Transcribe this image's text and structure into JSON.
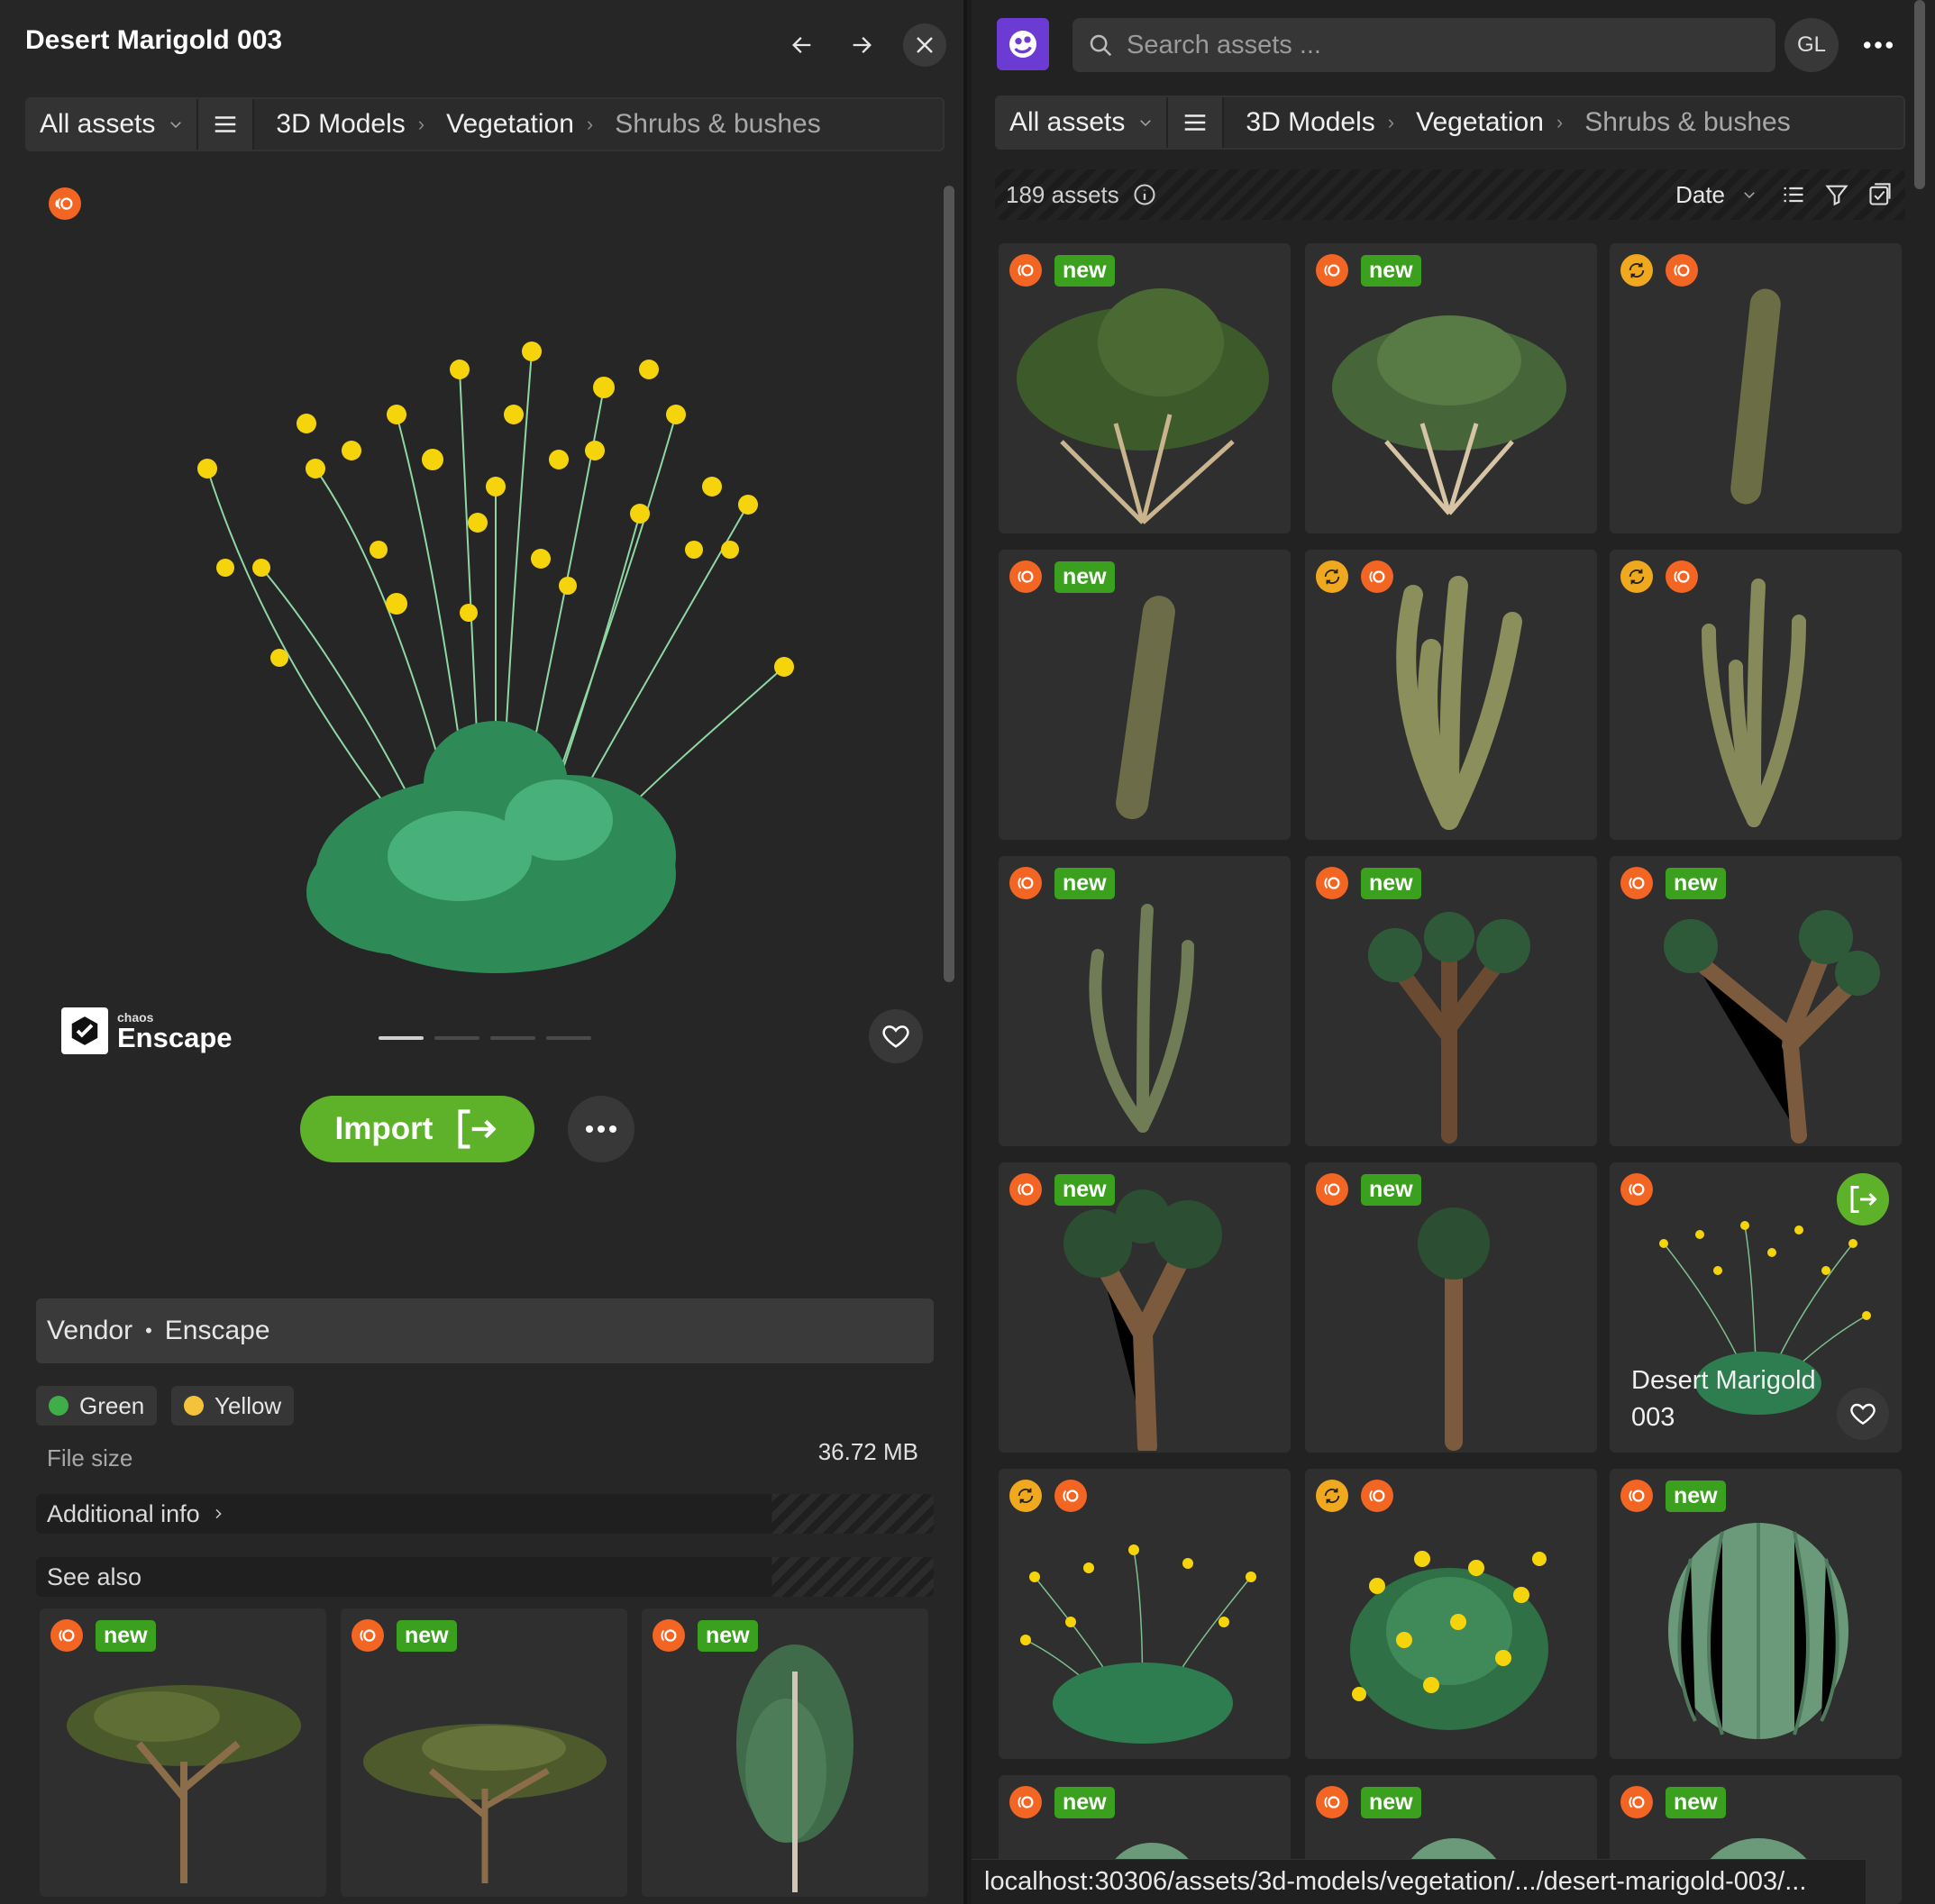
{
  "detail": {
    "title": "Desert Marigold 003",
    "breadcrumb": {
      "all": "All assets",
      "items": [
        "3D Models",
        "Vegetation",
        "Shrubs & bushes"
      ]
    },
    "brand_small": "chaos",
    "brand": "Enscape",
    "import_label": "Import",
    "vendor_label": "Vendor",
    "vendor_sep": "•",
    "vendor_value": "Enscape",
    "tags": [
      {
        "label": "Green",
        "color": "#3fae49"
      },
      {
        "label": "Yellow",
        "color": "#f5c33b"
      }
    ],
    "file_size_label": "File size",
    "file_size_value": "36.72 MB",
    "additional_info": "Additional info",
    "see_also": "See also",
    "new_badge": "new",
    "see_also_items": [
      {
        "icon": "tree-icon",
        "new": true
      },
      {
        "icon": "tree-icon",
        "new": true
      },
      {
        "icon": "tree-icon",
        "new": true
      }
    ]
  },
  "browser": {
    "search_placeholder": "Search assets ...",
    "user_initials": "GL",
    "breadcrumb": {
      "all": "All assets",
      "items": [
        "3D Models",
        "Vegetation",
        "Shrubs & bushes"
      ]
    },
    "count": "189 assets",
    "sort": "Date",
    "hover_title_1": "Desert Marigold",
    "hover_title_2": "003",
    "new_badge": "new"
  },
  "status_url": "localhost:30306/assets/3d-models/vegetation/.../desert-marigold-003/...",
  "colors": {
    "accent_green": "#5eb22a",
    "new_badge": "#3aa01e",
    "chaos_orange": "#f26522",
    "sync_yellow": "#f0a81e"
  }
}
